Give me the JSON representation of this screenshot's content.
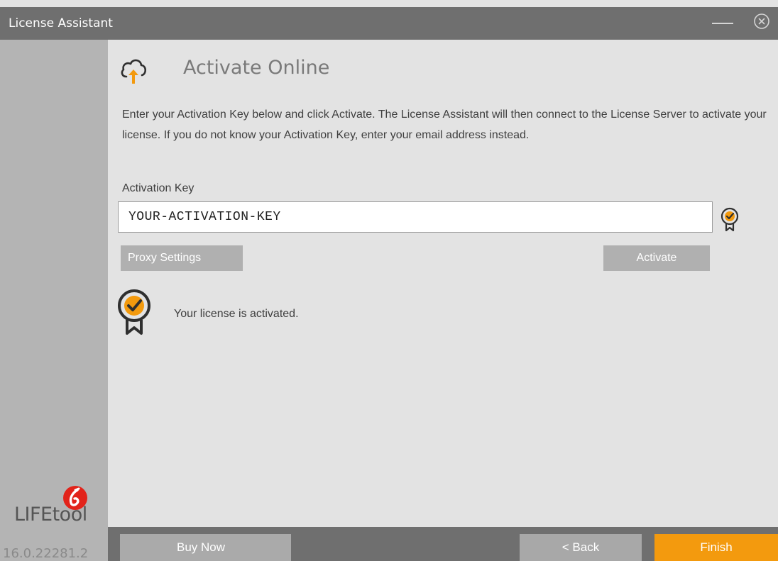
{
  "window": {
    "title": "License Assistant",
    "minimize_icon": "minimize-icon",
    "close_icon": "close-circle-icon"
  },
  "sidebar": {
    "logo_text": "LIFEtool",
    "version": "16.0.22281.2"
  },
  "header": {
    "icon": "cloud-upload-icon",
    "title": "Activate Online"
  },
  "main": {
    "description": "Enter your Activation Key below and click Activate. The License Assistant will then connect to the License Server to activate your license. If you do not know your Activation Key, enter your email address instead.",
    "key_label": "Activation Key",
    "key_value": "YOUR-ACTIVATION-KEY",
    "key_status_icon": "certificate-check-icon",
    "proxy_button": "Proxy Settings",
    "activate_button": "Activate",
    "status_icon": "certificate-check-icon",
    "status_text": "Your license is activated."
  },
  "footer": {
    "buy_now": "Buy Now",
    "back": "< Back",
    "finish": "Finish"
  },
  "colors": {
    "titlebar": "#6f6f6f",
    "sidebar": "#b4b4b4",
    "background": "#e3e3e3",
    "accent": "#f39a0e",
    "button": "#b0b0b0"
  }
}
